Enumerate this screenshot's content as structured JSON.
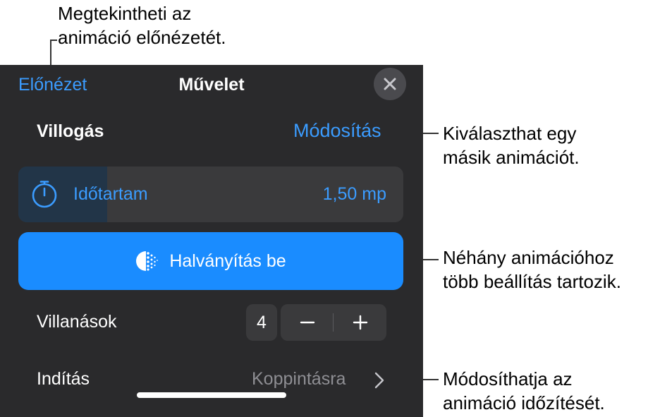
{
  "callouts": {
    "preview": {
      "line1": "Megtekintheti az",
      "line2": "animáció előnézetét."
    },
    "change": {
      "line1": "Kiválaszthat egy",
      "line2": "másik animációt."
    },
    "options": {
      "line1": "Néhány animációhoz",
      "line2": "több beállítás tartozik."
    },
    "timing": {
      "line1": "Módosíthatja az",
      "line2": "animáció időzítését."
    }
  },
  "header": {
    "preview_label": "Előnézet",
    "title": "Művelet"
  },
  "animation": {
    "name": "Villogás",
    "change_label": "Módosítás"
  },
  "duration": {
    "label": "Időtartam",
    "value": "1,50 mp",
    "fill_fraction": 0.23
  },
  "fade_button": {
    "label": "Halványítás be"
  },
  "flashes": {
    "label": "Villanások",
    "count": "4"
  },
  "start": {
    "label": "Indítás",
    "value": "Koppintásra"
  },
  "colors": {
    "accent": "#1a8cff",
    "link": "#3b9cff",
    "panel_bg": "#2a2a2c",
    "control_bg": "#3a3a3c"
  }
}
